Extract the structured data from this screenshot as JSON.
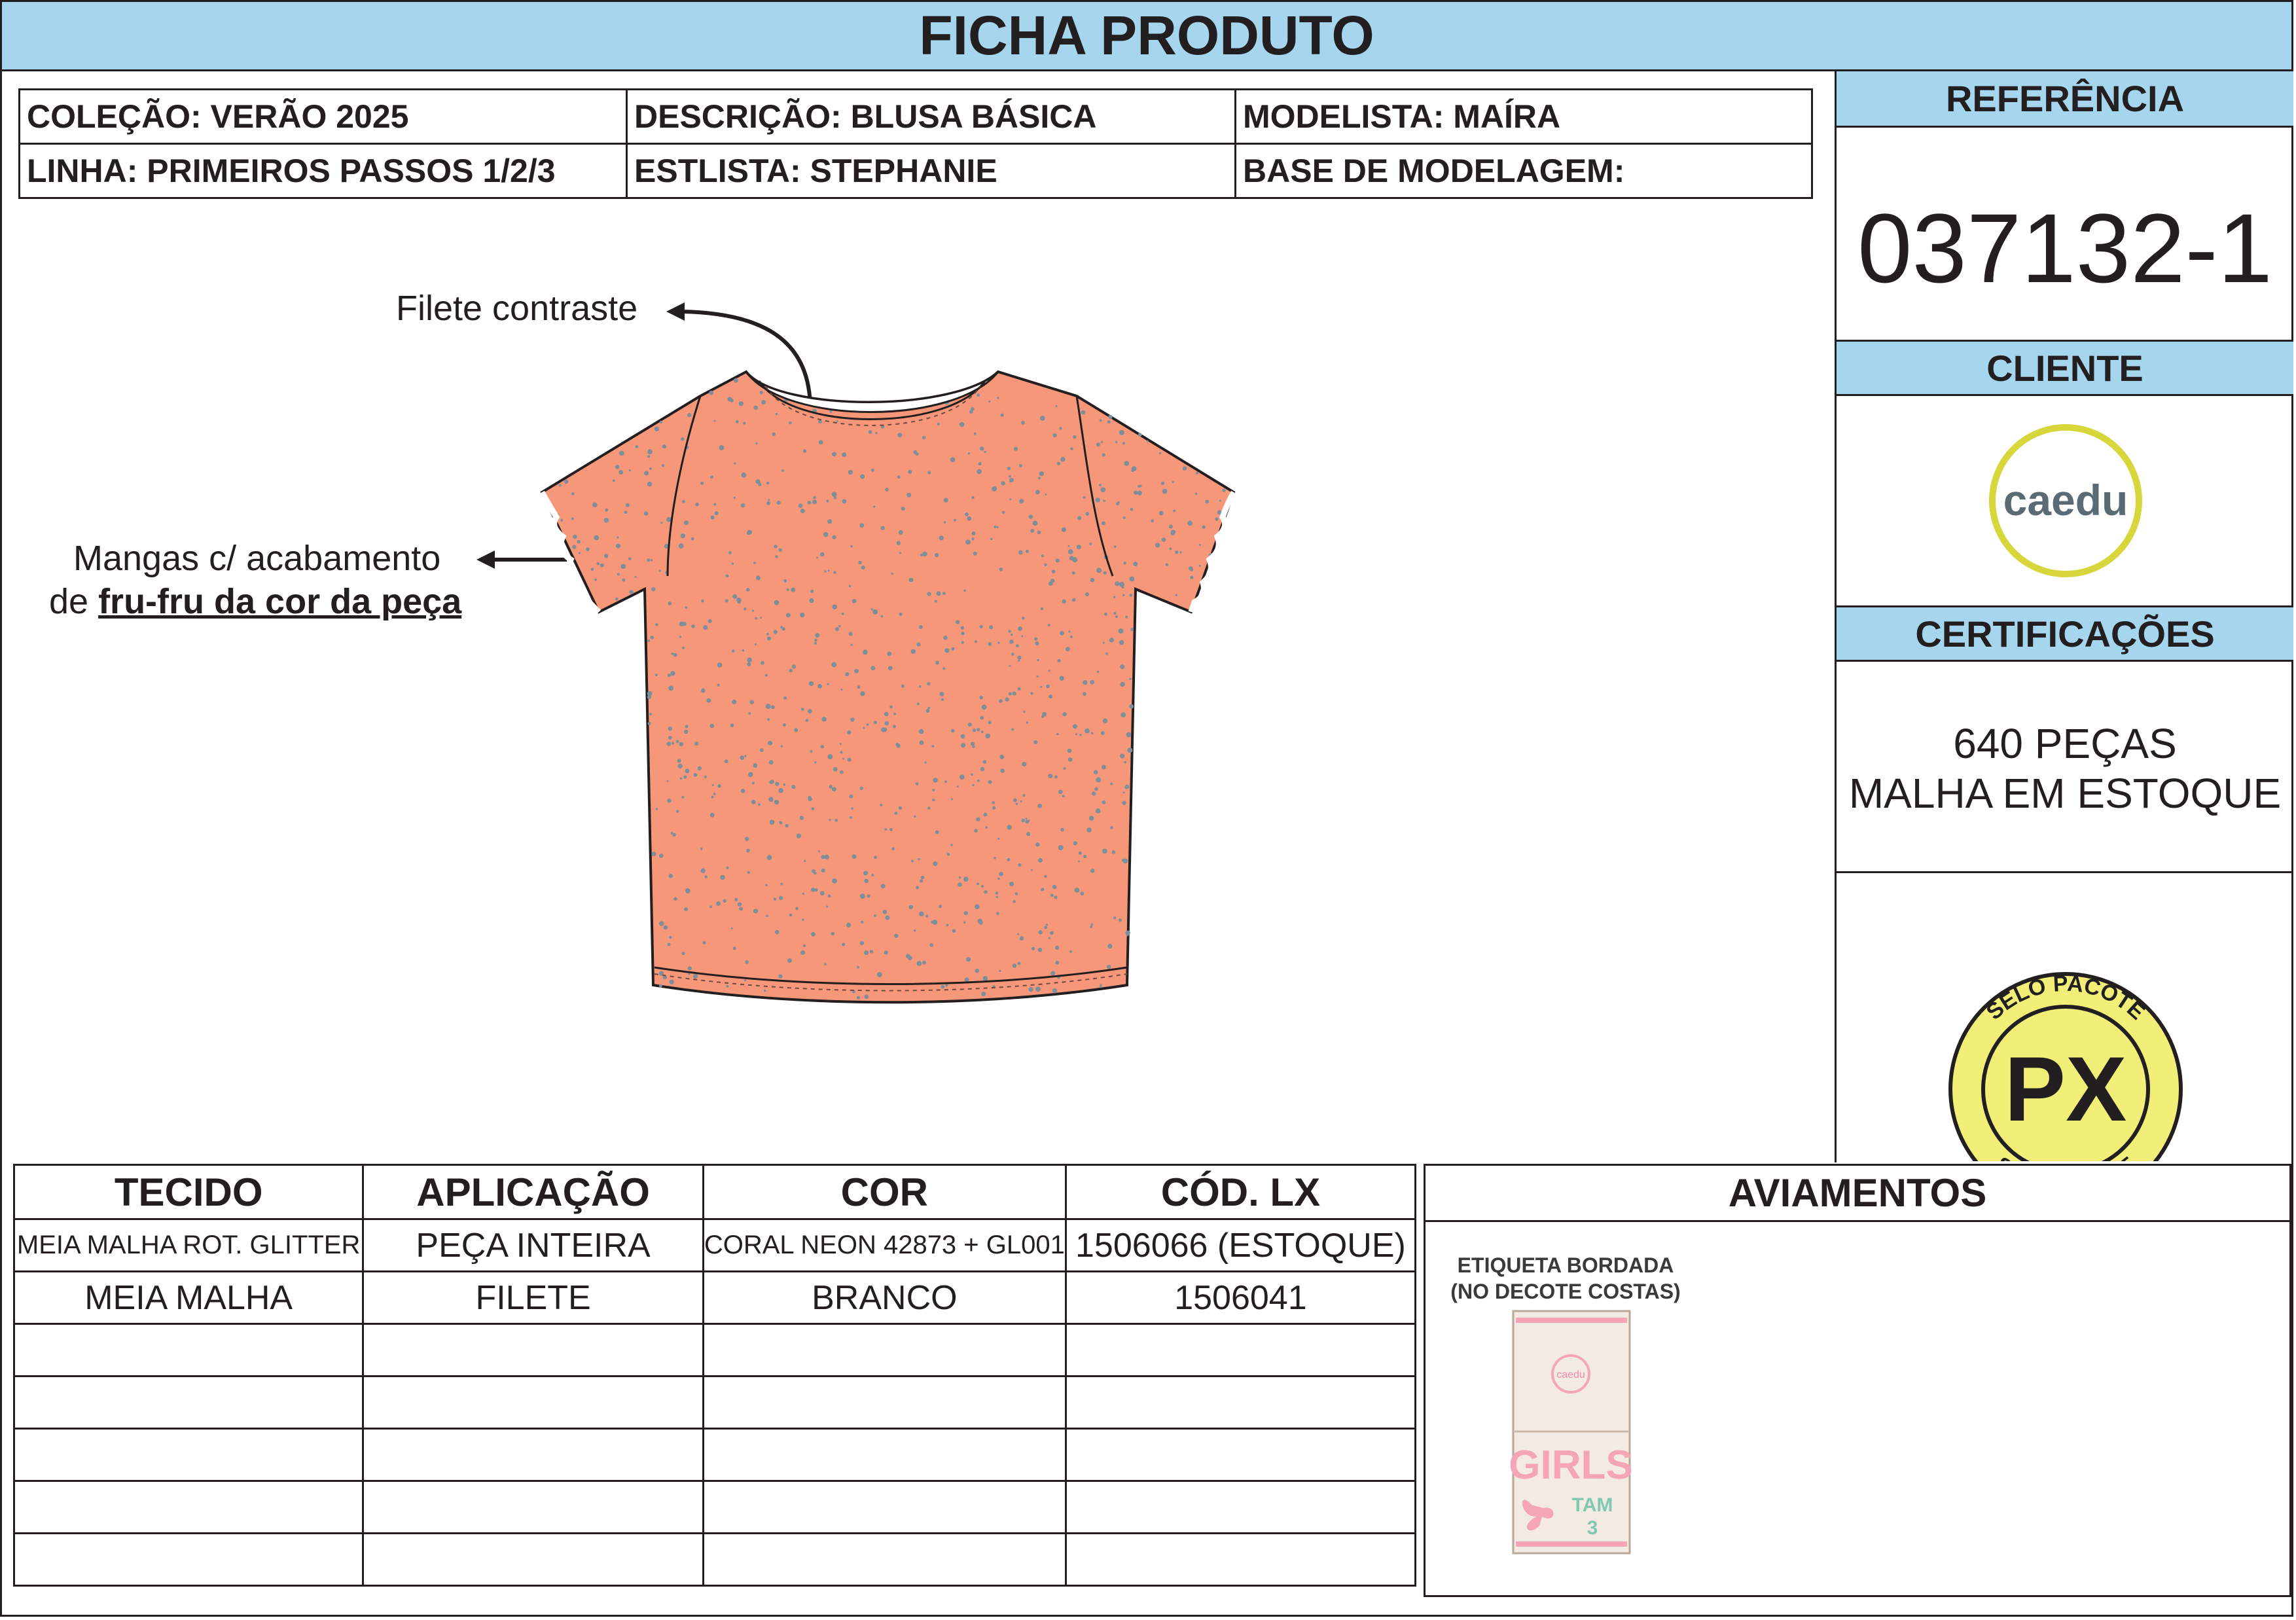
{
  "header": {
    "title": "FICHA PRODUTO"
  },
  "info": {
    "colecao": "COLEÇÃO: VERÃO 2025",
    "descricao": "DESCRIÇÃO: BLUSA BÁSICA",
    "modelista": "MODELISTA: MAÍRA",
    "linha": "LINHA: PRIMEIROS PASSOS 1/2/3",
    "estilista": "ESTLISTA: STEPHANIE",
    "base": "BASE DE MODELAGEM:"
  },
  "sidebar": {
    "referencia_label": "REFERÊNCIA",
    "referencia_value": "037132-1",
    "cliente_label": "CLIENTE",
    "cliente_logo": "caedu",
    "certificacoes_label": "CERTIFICAÇÕES",
    "cert_line1": "640 PEÇAS",
    "cert_line2": "MALHA EM ESTOQUE",
    "seal_top": "SELO PACOTE",
    "seal_center": "PX",
    "seal_bottom": "SELO PACOTE"
  },
  "drawing": {
    "annotation_filete": "Filete contraste",
    "annotation_mangas_line1": "Mangas c/ acabamento",
    "annotation_mangas_prefix": "de ",
    "annotation_mangas_bold": "fru-fru da cor da peça",
    "garment_color": "#f7977a",
    "speckle_color": "#7f8f9a"
  },
  "fabric_table": {
    "headers": [
      "TECIDO",
      "APLICAÇÃO",
      "COR",
      "CÓD. LX"
    ],
    "rows": [
      [
        "MEIA MALHA ROT. GLITTER",
        "PEÇA INTEIRA",
        "CORAL NEON 42873 + GL001",
        "1506066 (ESTOQUE)"
      ],
      [
        "MEIA MALHA",
        "FILETE",
        "BRANCO",
        "1506041"
      ],
      [
        "",
        "",
        "",
        ""
      ],
      [
        "",
        "",
        "",
        ""
      ],
      [
        "",
        "",
        "",
        ""
      ],
      [
        "",
        "",
        "",
        ""
      ],
      [
        "",
        "",
        "",
        ""
      ]
    ]
  },
  "aviamentos": {
    "title": "AVIAMENTOS",
    "label_title_line1": "ETIQUETA BORDADA",
    "label_title_line2": "(NO DECOTE COSTAS)",
    "label_brand": "caedu",
    "label_text": "GIRLS",
    "label_tam": "TAM",
    "label_size": "3"
  },
  "colors": {
    "header_blue": "#a6d6ee",
    "border": "#231f20",
    "seal_yellow": "#f2ef78",
    "logo_ring": "#d7d63b",
    "logo_text": "#5a6b73"
  }
}
